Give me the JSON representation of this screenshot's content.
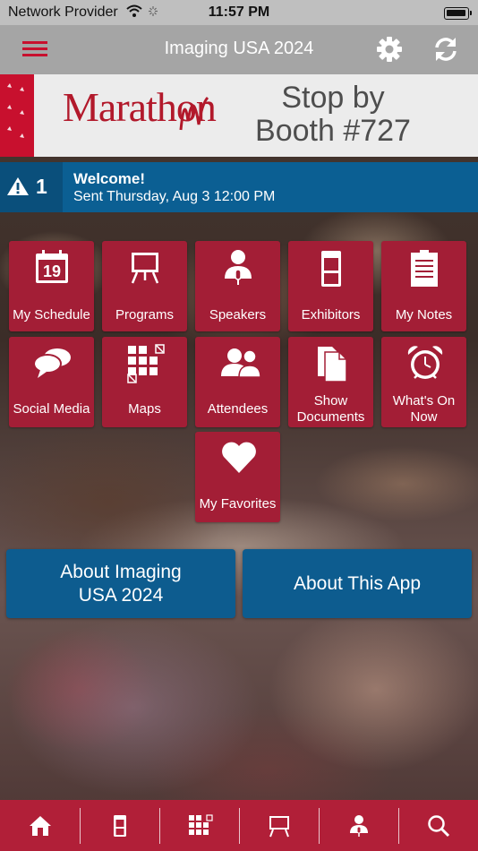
{
  "status_bar": {
    "carrier": "Network Provider",
    "time": "11:57 PM"
  },
  "nav": {
    "title": "Imaging USA 2024"
  },
  "banner": {
    "brand": "Marathon",
    "cta_line1": "Stop by",
    "cta_line2": "Booth #727"
  },
  "alert": {
    "count": "1",
    "title": "Welcome!",
    "subtitle": "Sent Thursday, Aug 3 12:00 PM"
  },
  "tiles": {
    "my_schedule": {
      "label": "My Schedule",
      "day": "19"
    },
    "programs": {
      "label": "Programs"
    },
    "speakers": {
      "label": "Speakers"
    },
    "exhibitors": {
      "label": "Exhibitors"
    },
    "my_notes": {
      "label": "My Notes"
    },
    "social_media": {
      "label": "Social Media"
    },
    "maps": {
      "label": "Maps"
    },
    "attendees": {
      "label": "Attendees"
    },
    "show_documents": {
      "label_line1": "Show",
      "label_line2": "Documents"
    },
    "whats_on_now": {
      "label_line1": "What's On",
      "label_line2": "Now"
    },
    "my_favorites": {
      "label": "My Favorites"
    }
  },
  "buttons": {
    "about_event_line1": "About Imaging",
    "about_event_line2": "USA 2024",
    "about_app": "About This App"
  },
  "colors": {
    "tile_red": "#a31e36",
    "button_blue": "#0d5c8f",
    "tabbar_red": "#b11f38",
    "nav_gray": "#a5a5a5"
  },
  "tab_icons": [
    "home-icon",
    "exhibitor-icon",
    "maps-icon",
    "programs-icon",
    "speakers-icon",
    "search-icon"
  ]
}
